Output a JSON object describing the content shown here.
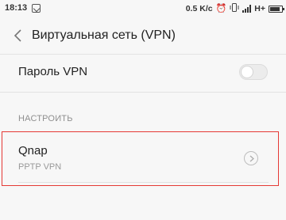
{
  "status_bar": {
    "time": "18:13",
    "speed": "0.5 K/c",
    "network_type": "H+",
    "icons": [
      "notification-icon",
      "alarm-icon",
      "vibrate-icon",
      "signal-icon",
      "battery-icon"
    ]
  },
  "header": {
    "title": "Виртуальная сеть (VPN)",
    "back_icon": "chevron-left-icon"
  },
  "password_row": {
    "label": "Пароль VPN",
    "toggle_on": false
  },
  "section": {
    "header": "НАСТРОИТЬ"
  },
  "vpn_list": [
    {
      "name": "Qnap",
      "type": "PPTP VPN",
      "action_icon": "chevron-right-circle-icon"
    }
  ],
  "colors": {
    "background": "#f7f7f7",
    "highlight_border": "#e53935",
    "secondary_text": "#999999"
  }
}
